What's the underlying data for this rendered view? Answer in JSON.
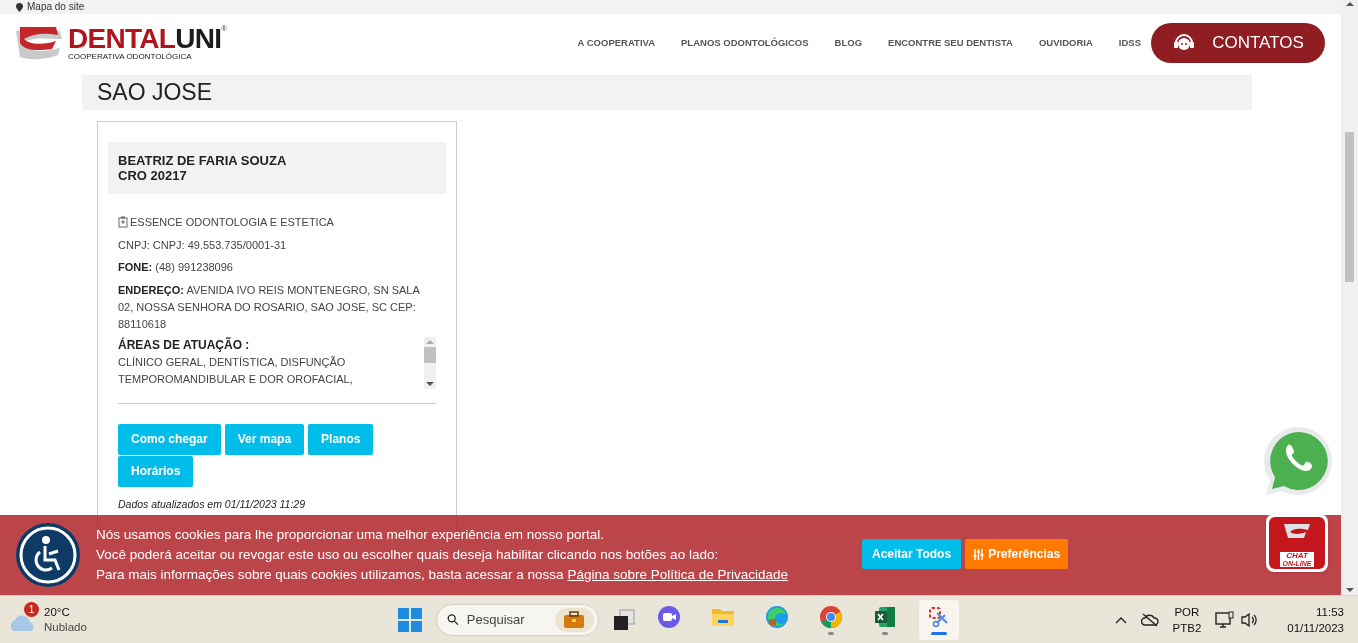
{
  "top_bar": {
    "link": "Mapa do site"
  },
  "header": {
    "logo": {
      "word_red": "DENTAL",
      "word_dark": "UNI",
      "registered": "®",
      "tagline": "COOPERATIVA ODONTOLÓGICA"
    },
    "nav": [
      "A COOPERATIVA",
      "PLANOS ODONTOLÓGICOS",
      "BLOG",
      "ENCONTRE SEU DENTISTA",
      "OUVIDORIA",
      "IDSS"
    ],
    "contact_button": "CONTATOS"
  },
  "city_title": "SAO JOSE",
  "dentist_card": {
    "name": "BEATRIZ DE FARIA SOUZA",
    "cro": "CRO 20217",
    "clinic": "ESSENCE ODONTOLOGIA E ESTETICA",
    "cnpj": "CNPJ: CNPJ: 49.553.735/0001-31",
    "phone_label": "FONE:",
    "phone": "(48) 991238096",
    "address_label": "ENDEREÇO:",
    "address": "AVENIDA IVO REIS MONTENEGRO, SN SALA 02, NOSSA SENHORA DO ROSARIO, SAO JOSE, SC CEP: 88110618",
    "areas_label": "ÁREAS DE ATUAÇÃO :",
    "areas": "CLÍNICO GERAL, DENTÍSTICA, DISFUNÇÃO TEMPOROMANDIBULAR E DOR OROFACIAL,",
    "buttons": [
      "Como chegar",
      "Ver mapa",
      "Planos",
      "Horários"
    ],
    "updated": "Dados atualizados em 01/11/2023 11:29"
  },
  "cookie_banner": {
    "lines": [
      "Nós usamos cookies para lhe proporcionar uma melhor experiência em nosso portal.",
      "Você poderá aceitar ou revogar este uso ou escolher quais deseja habilitar clicando nos botões ao lado:"
    ],
    "last_line": "Para mais informações sobre quais cookies utilizamos, basta acessar a nossa",
    "policy_link": "Página sobre Política de Privacidade",
    "accept_button": "Aceitar Todos",
    "preferences_button": "Preferências"
  },
  "chat_badge": {
    "line1": "CHAT",
    "line2": "ON-LINE"
  },
  "taskbar": {
    "weather": {
      "temp": "20°C",
      "condition": "Nublado",
      "badge": "1"
    },
    "search_placeholder": "Pesquisar",
    "apps": [
      {
        "kind": "meet",
        "running": false,
        "active": false
      },
      {
        "kind": "files",
        "running": false,
        "active": false
      },
      {
        "kind": "edge",
        "running": false,
        "active": false
      },
      {
        "kind": "chrome",
        "running": true,
        "active": false
      },
      {
        "kind": "excel",
        "running": true,
        "active": false
      },
      {
        "kind": "snip",
        "running": true,
        "active": true
      }
    ],
    "language": "POR",
    "layout": "PTB2",
    "time": "11:53",
    "date": "01/11/2023"
  }
}
